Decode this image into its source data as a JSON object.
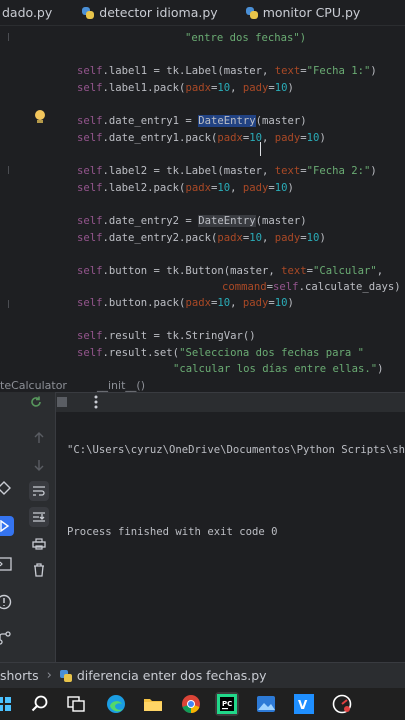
{
  "tabs": [
    {
      "label": "dado.py"
    },
    {
      "label": "detector idioma.py"
    },
    {
      "label": "monitor CPU.py"
    }
  ],
  "code": {
    "l0_str": "\"entre dos fechas\")",
    "l1_a": "self",
    "l1_b": ".label1 = tk.Label(master, ",
    "l1_c": "text",
    "l1_d": "=",
    "l1_e": "\"Fecha 1:\"",
    "l1_f": ")",
    "l2_a": "self",
    "l2_b": ".label1.pack(",
    "l2_c": "padx",
    "l2_d": "=",
    "l2_e": "10",
    "l2_f": ", ",
    "l2_g": "pady",
    "l2_h": "=",
    "l2_i": "10",
    "l2_j": ")",
    "l3_a": "self",
    "l3_b": ".date_entry1 = ",
    "l3_c": "DateEntry",
    "l3_d": "(master)",
    "l4_a": "self",
    "l4_b": ".date_entry1.pack(",
    "l4_c": "padx",
    "l4_d": "=",
    "l4_e": "10",
    "l4_f": ", ",
    "l4_g": "pady",
    "l4_h": "=",
    "l4_i": "10",
    "l4_j": ")",
    "l5_a": "self",
    "l5_b": ".label2 = tk.Label(master, ",
    "l5_c": "text",
    "l5_d": "=",
    "l5_e": "\"Fecha 2:\"",
    "l5_f": ")",
    "l6_a": "self",
    "l6_b": ".label2.pack(",
    "l6_c": "padx",
    "l6_d": "=",
    "l6_e": "10",
    "l6_f": ", ",
    "l6_g": "pady",
    "l6_h": "=",
    "l6_i": "10",
    "l6_j": ")",
    "l7_a": "self",
    "l7_b": ".date_entry2 = ",
    "l7_c": "DateEntry",
    "l7_d": "(master)",
    "l8_a": "self",
    "l8_b": ".date_entry2.pack(",
    "l8_c": "padx",
    "l8_d": "=",
    "l8_e": "10",
    "l8_f": ", ",
    "l8_g": "pady",
    "l8_h": "=",
    "l8_i": "10",
    "l8_j": ")",
    "l9_a": "self",
    "l9_b": ".button = tk.Button(master, ",
    "l9_c": "text",
    "l9_d": "=",
    "l9_e": "\"Calcular\"",
    "l9_f": ",",
    "l10_a": "command",
    "l10_b": "=",
    "l10_c": "self",
    "l10_d": ".calculate_days)",
    "l11_a": "self",
    "l11_b": ".button.pack(",
    "l11_c": "padx",
    "l11_d": "=",
    "l11_e": "10",
    "l11_f": ", ",
    "l11_g": "pady",
    "l11_h": "=",
    "l11_i": "10",
    "l11_j": ")",
    "l12_a": "self",
    "l12_b": ".result = tk.StringVar()",
    "l13_a": "self",
    "l13_b": ".result.set(",
    "l13_c": "\"Selecciona dos fechas para \"",
    "l14_a": "\"calcular los días entre ellas.\"",
    "l14_b": ")"
  },
  "breadcrumb_editor": {
    "class_name": "teCalculator",
    "method": "__init__()"
  },
  "console": {
    "command": "\"C:\\Users\\cyruz\\OneDrive\\Documentos\\Python Scripts\\shor",
    "exit_message": "Process finished with exit code 0"
  },
  "statusbar": {
    "folder": "shorts",
    "file": "diferencia enter dos fechas.py"
  },
  "colors": {
    "keyword": "#94558d",
    "string": "#6aab73",
    "number": "#2aacb8",
    "param": "#aa4926",
    "selection": "#214283"
  }
}
